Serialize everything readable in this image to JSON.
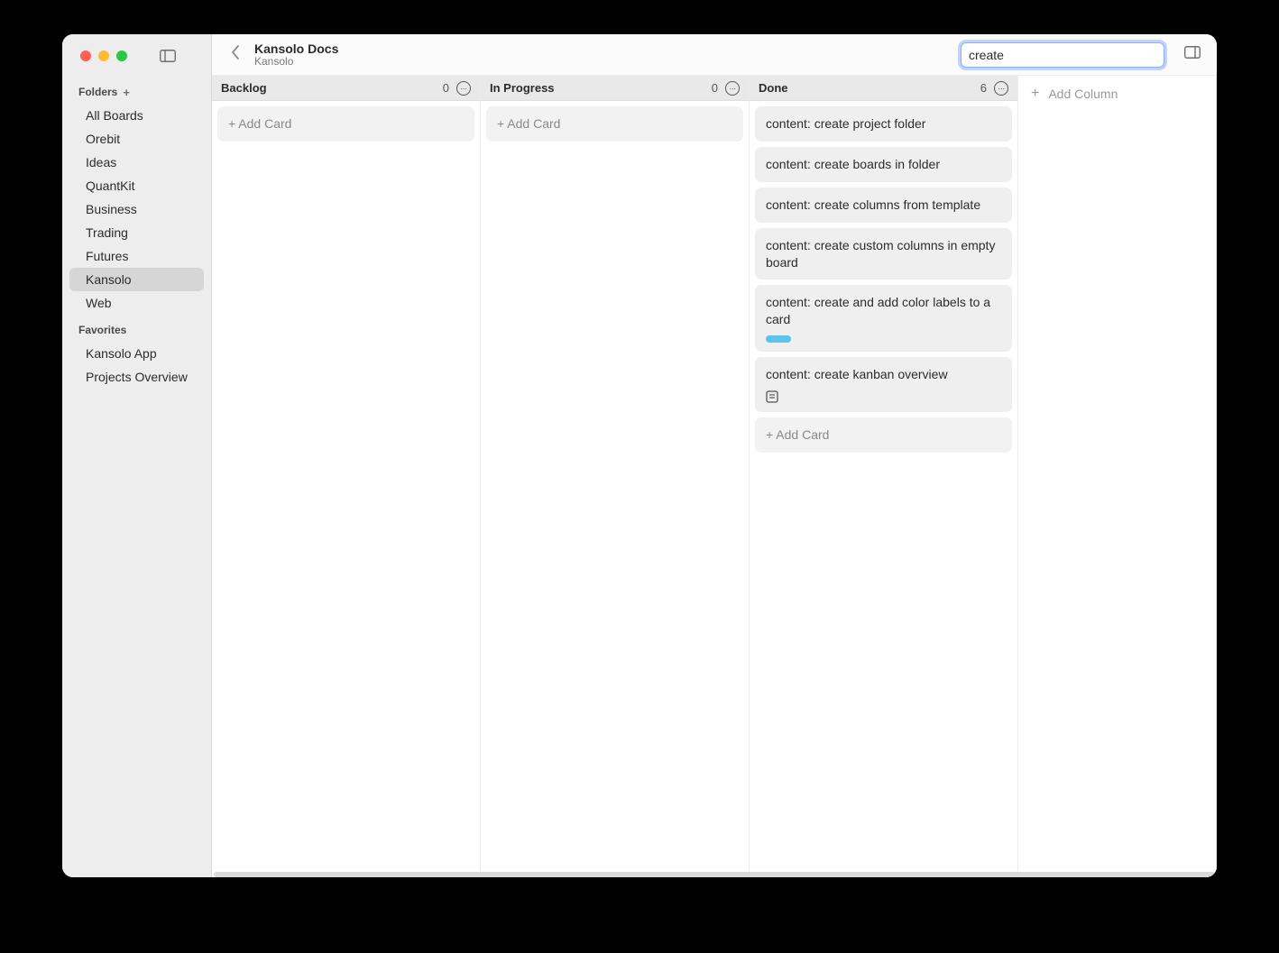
{
  "header": {
    "title": "Kansolo Docs",
    "subtitle": "Kansolo"
  },
  "search": {
    "value": "create"
  },
  "sidebar": {
    "folders_label": "Folders",
    "favorites_label": "Favorites",
    "folders": [
      {
        "label": "All Boards",
        "selected": false
      },
      {
        "label": "Orebit",
        "selected": false
      },
      {
        "label": "Ideas",
        "selected": false
      },
      {
        "label": "QuantKit",
        "selected": false
      },
      {
        "label": "Business",
        "selected": false
      },
      {
        "label": "Trading",
        "selected": false
      },
      {
        "label": "Futures",
        "selected": false
      },
      {
        "label": "Kansolo",
        "selected": true
      },
      {
        "label": "Web",
        "selected": false
      }
    ],
    "favorites": [
      {
        "label": "Kansolo App"
      },
      {
        "label": "Projects Overview"
      }
    ]
  },
  "columns": [
    {
      "title": "Backlog",
      "count": "0",
      "add_card_label": "+ Add Card",
      "cards": []
    },
    {
      "title": "In Progress",
      "count": "0",
      "add_card_label": "+ Add Card",
      "cards": []
    },
    {
      "title": "Done",
      "count": "6",
      "add_card_label": "+ Add Card",
      "cards": [
        {
          "title": "content: create project folder"
        },
        {
          "title": "content: create boards in folder"
        },
        {
          "title": "content: create columns from template"
        },
        {
          "title": "content: create custom columns in empty board"
        },
        {
          "title": "content: create and add color labels to a card",
          "has_label": true,
          "label_color": "#5ec3eb"
        },
        {
          "title": "content: create kanban overview",
          "has_notes_icon": true
        }
      ]
    }
  ],
  "add_column_label": "Add Column"
}
